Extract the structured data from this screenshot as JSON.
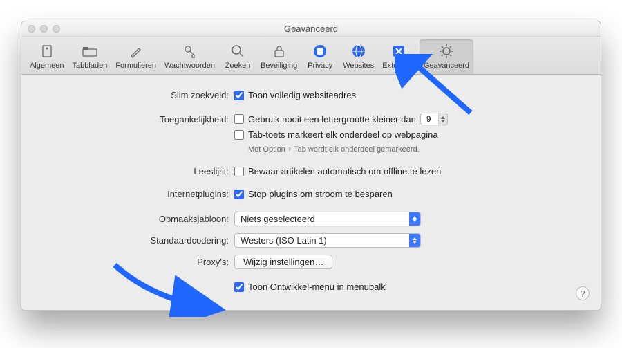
{
  "window_title": "Geavanceerd",
  "toolbar": [
    {
      "label": "Algemeen"
    },
    {
      "label": "Tabbladen"
    },
    {
      "label": "Formulieren"
    },
    {
      "label": "Wachtwoorden"
    },
    {
      "label": "Zoeken"
    },
    {
      "label": "Beveiliging"
    },
    {
      "label": "Privacy"
    },
    {
      "label": "Websites"
    },
    {
      "label": "Extensies"
    },
    {
      "label": "Geavanceerd"
    }
  ],
  "sections": {
    "slim_zoekveld": {
      "label": "Slim zoekveld:",
      "option": "Toon volledig websiteadres"
    },
    "toegankelijkheid": {
      "label": "Toegankelijkheid:",
      "option1": "Gebruik nooit een lettergrootte kleiner dan",
      "fontsize": "9",
      "option2": "Tab-toets markeert elk onderdeel op webpagina",
      "hint": "Met Option + Tab wordt elk onderdeel gemarkeerd."
    },
    "leeslijst": {
      "label": "Leeslijst:",
      "option": "Bewaar artikelen automatisch om offline te lezen"
    },
    "internetplugins": {
      "label": "Internetplugins:",
      "option": "Stop plugins om stroom te besparen"
    },
    "opmaaksjabloon": {
      "label": "Opmaaksjabloon:",
      "value": "Niets geselecteerd"
    },
    "standaardcodering": {
      "label": "Standaardcodering:",
      "value": "Westers (ISO Latin 1)"
    },
    "proxy": {
      "label": "Proxy's:",
      "button": "Wijzig instellingen…"
    },
    "ontwikkel": {
      "option": "Toon Ontwikkel-menu in menubalk"
    }
  },
  "help": "?"
}
